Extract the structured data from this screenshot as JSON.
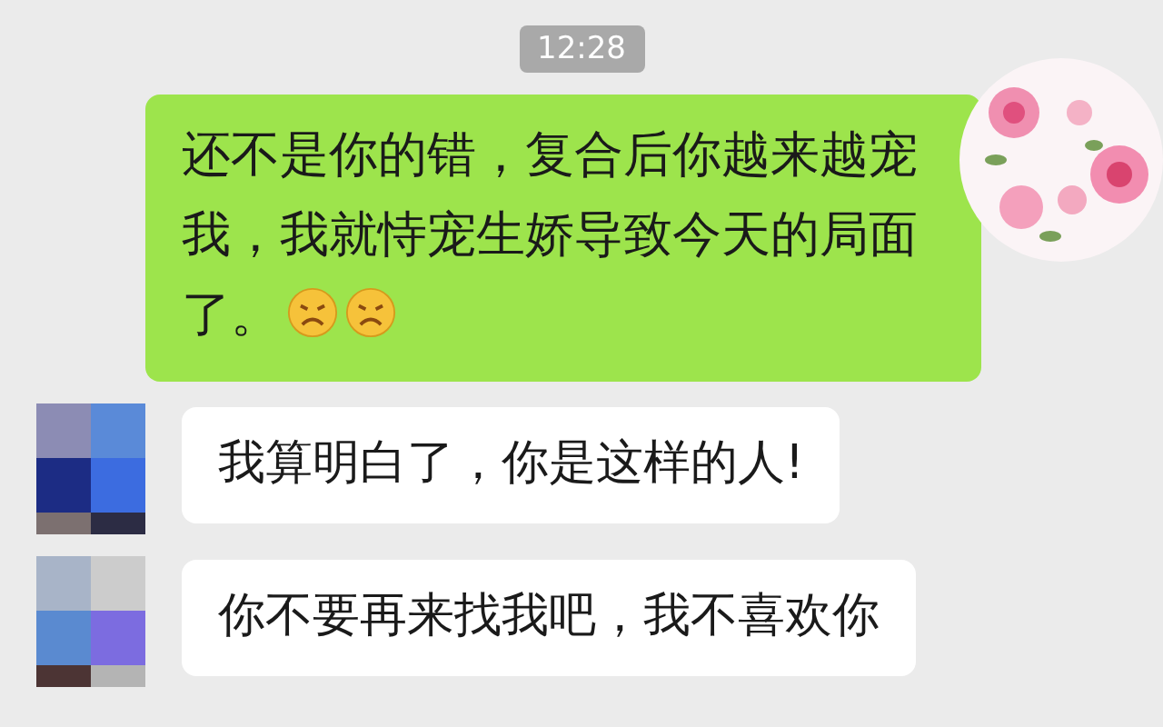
{
  "timestamp": "12:28",
  "messages": [
    {
      "kind": "sent",
      "text": "还不是你的错，复合后你越来越宠我，我就恃宠生娇导致今天的局面了。",
      "trailing_icons": [
        {
          "kind": "sad-face"
        },
        {
          "kind": "sad-face"
        }
      ]
    },
    {
      "kind": "received",
      "text": "我算明白了，你是这样的人!"
    },
    {
      "kind": "received",
      "text": "你不要再来找我吧，我不喜欢你"
    }
  ]
}
